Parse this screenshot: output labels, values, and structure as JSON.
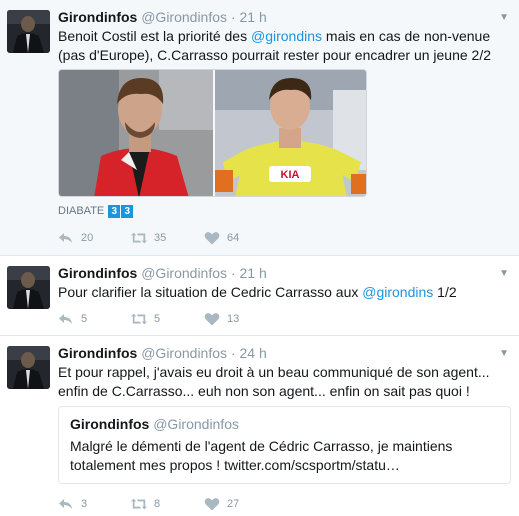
{
  "tweets": [
    {
      "name": "Girondinfos",
      "handle": "@Girondinfos",
      "dot": "·",
      "time": "21 h",
      "text_before": "Benoit Costil est la priorité des ",
      "mention": "@girondins",
      "text_after": " mais en cas de non-venue (pas d'Europe), C.Carrasso pourrait rester pour encadrer un jeune 2/2",
      "tagged_label": "DIABATE",
      "tagged_numbers": [
        "3",
        "3"
      ],
      "replies": "20",
      "retweets": "35",
      "likes": "64"
    },
    {
      "name": "Girondinfos",
      "handle": "@Girondinfos",
      "dot": "·",
      "time": "21 h",
      "text_before": "Pour clarifier la situation de Cedric Carrasso aux ",
      "mention": "@girondins",
      "text_after": " 1/2",
      "replies": "5",
      "retweets": "5",
      "likes": "13"
    },
    {
      "name": "Girondinfos",
      "handle": "@Girondinfos",
      "dot": "·",
      "time": "24 h",
      "text": "Et pour rappel, j'avais eu droit à un beau communiqué de son agent... enfin de C.Carrasso... euh non son agent... enfin on sait pas quoi !",
      "quote": {
        "name": "Girondinfos",
        "handle": "@Girondinfos",
        "text": "Malgré le démenti de l'agent de Cédric Carrasso, je maintiens totalement mes propos ! twitter.com/scsportm/statu…"
      },
      "replies": "3",
      "retweets": "8",
      "likes": "27"
    }
  ],
  "colors": {
    "mention": "#1b95e0",
    "meta": "#8899a6",
    "highlight_bg": "#f5f8fa"
  },
  "icons": [
    "reply-icon",
    "retweet-icon",
    "heart-icon",
    "caret-down-icon"
  ]
}
